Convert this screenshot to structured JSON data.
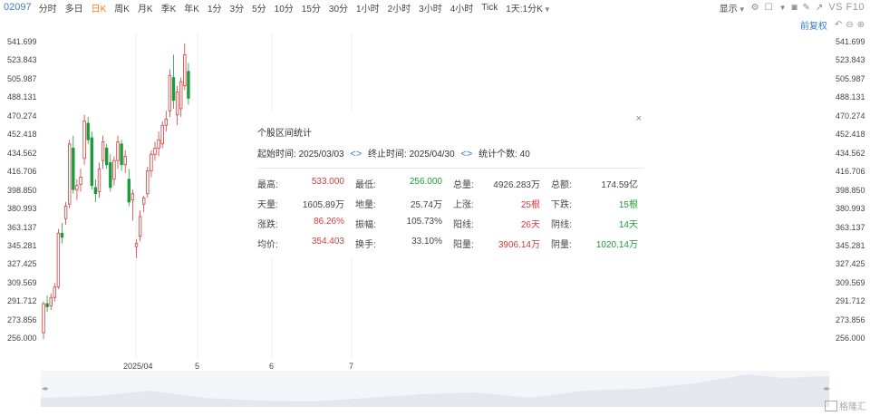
{
  "header": {
    "code": "02097",
    "periods": [
      "分时",
      "多日",
      "日K",
      "周K",
      "月K",
      "季K",
      "年K",
      "1分",
      "3分",
      "5分",
      "10分",
      "15分",
      "30分",
      "1小时",
      "2小时",
      "3小时",
      "4小时",
      "Tick",
      "1天:1分K"
    ],
    "active_period": 2,
    "display_label": "显示",
    "vs_label": "VS F10"
  },
  "adjust": {
    "label": "前复权"
  },
  "y_axis": [
    "541.699",
    "523.843",
    "505.987",
    "488.131",
    "470.274",
    "452.418",
    "434.562",
    "416.706",
    "398.850",
    "380.993",
    "363.137",
    "345.281",
    "327.425",
    "309.569",
    "291.712",
    "273.856",
    "256.000"
  ],
  "x_axis": [
    "2025/04",
    "5",
    "6",
    "7"
  ],
  "stats_popup": {
    "title": "个股区间统计",
    "start_label": "起始时间:",
    "start_value": "2025/03/03",
    "end_label": "终止时间:",
    "end_value": "2025/04/30",
    "count_label": "统计个数:",
    "count_value": "40",
    "rows": [
      [
        {
          "k": "最高:",
          "v": "533.000",
          "c": "red"
        },
        {
          "k": "最低:",
          "v": "256.000",
          "c": "green"
        },
        {
          "k": "总量:",
          "v": "4926.283万",
          "c": "dark"
        },
        {
          "k": "总额:",
          "v": "174.59亿",
          "c": "dark"
        }
      ],
      [
        {
          "k": "天量:",
          "v": "1605.89万",
          "c": "dark"
        },
        {
          "k": "地量:",
          "v": "25.74万",
          "c": "dark"
        },
        {
          "k": "上涨:",
          "v": "25根",
          "c": "red"
        },
        {
          "k": "下跌:",
          "v": "15根",
          "c": "green"
        }
      ],
      [
        {
          "k": "涨跌:",
          "v": "86.26%",
          "c": "red"
        },
        {
          "k": "振幅:",
          "v": "105.73%",
          "c": "dark"
        },
        {
          "k": "阳线:",
          "v": "26天",
          "c": "red"
        },
        {
          "k": "阴线:",
          "v": "14天",
          "c": "green"
        }
      ],
      [
        {
          "k": "均价:",
          "v": "354.403",
          "c": "red"
        },
        {
          "k": "换手:",
          "v": "33.10%",
          "c": "dark"
        },
        {
          "k": "阳量:",
          "v": "3906.14万",
          "c": "red"
        },
        {
          "k": "阴量:",
          "v": "1020.14万",
          "c": "green"
        }
      ]
    ]
  },
  "chart_data": {
    "type": "candlestick",
    "ylim": [
      256.0,
      541.699
    ],
    "x_ticks": [
      "2025/04",
      "5",
      "6",
      "7"
    ],
    "candles": [
      {
        "o": 262,
        "h": 292,
        "l": 256,
        "c": 290
      },
      {
        "o": 290,
        "h": 298,
        "l": 282,
        "c": 287
      },
      {
        "o": 288,
        "h": 300,
        "l": 284,
        "c": 296
      },
      {
        "o": 296,
        "h": 310,
        "l": 292,
        "c": 306
      },
      {
        "o": 306,
        "h": 362,
        "l": 304,
        "c": 358
      },
      {
        "o": 358,
        "h": 368,
        "l": 348,
        "c": 354
      },
      {
        "o": 372,
        "h": 388,
        "l": 366,
        "c": 384
      },
      {
        "o": 386,
        "h": 448,
        "l": 382,
        "c": 444
      },
      {
        "o": 440,
        "h": 452,
        "l": 396,
        "c": 400
      },
      {
        "o": 400,
        "h": 410,
        "l": 390,
        "c": 404
      },
      {
        "o": 405,
        "h": 420,
        "l": 398,
        "c": 412
      },
      {
        "o": 430,
        "h": 472,
        "l": 424,
        "c": 466
      },
      {
        "o": 464,
        "h": 470,
        "l": 444,
        "c": 448
      },
      {
        "o": 450,
        "h": 456,
        "l": 400,
        "c": 404
      },
      {
        "o": 402,
        "h": 410,
        "l": 388,
        "c": 396
      },
      {
        "o": 398,
        "h": 426,
        "l": 392,
        "c": 420
      },
      {
        "o": 428,
        "h": 452,
        "l": 420,
        "c": 446
      },
      {
        "o": 440,
        "h": 444,
        "l": 420,
        "c": 424
      },
      {
        "o": 426,
        "h": 434,
        "l": 398,
        "c": 402
      },
      {
        "o": 410,
        "h": 432,
        "l": 404,
        "c": 428
      },
      {
        "o": 428,
        "h": 452,
        "l": 420,
        "c": 446
      },
      {
        "o": 444,
        "h": 448,
        "l": 418,
        "c": 424
      },
      {
        "o": 424,
        "h": 438,
        "l": 416,
        "c": 432
      },
      {
        "o": 410,
        "h": 420,
        "l": 384,
        "c": 388
      },
      {
        "o": 390,
        "h": 400,
        "l": 370,
        "c": 396
      },
      {
        "o": 345,
        "h": 352,
        "l": 334,
        "c": 348
      },
      {
        "o": 355,
        "h": 380,
        "l": 350,
        "c": 374
      },
      {
        "o": 386,
        "h": 394,
        "l": 378,
        "c": 392
      },
      {
        "o": 396,
        "h": 422,
        "l": 392,
        "c": 418
      },
      {
        "o": 418,
        "h": 438,
        "l": 412,
        "c": 434
      },
      {
        "o": 434,
        "h": 446,
        "l": 428,
        "c": 440
      },
      {
        "o": 440,
        "h": 456,
        "l": 432,
        "c": 448
      },
      {
        "o": 444,
        "h": 466,
        "l": 440,
        "c": 462
      },
      {
        "o": 462,
        "h": 476,
        "l": 456,
        "c": 468
      },
      {
        "o": 476,
        "h": 516,
        "l": 470,
        "c": 510
      },
      {
        "o": 508,
        "h": 530,
        "l": 478,
        "c": 486
      },
      {
        "o": 472,
        "h": 500,
        "l": 462,
        "c": 494
      },
      {
        "o": 478,
        "h": 508,
        "l": 470,
        "c": 504
      },
      {
        "o": 500,
        "h": 541,
        "l": 496,
        "c": 530
      },
      {
        "o": 514,
        "h": 522,
        "l": 482,
        "c": 488
      }
    ]
  }
}
